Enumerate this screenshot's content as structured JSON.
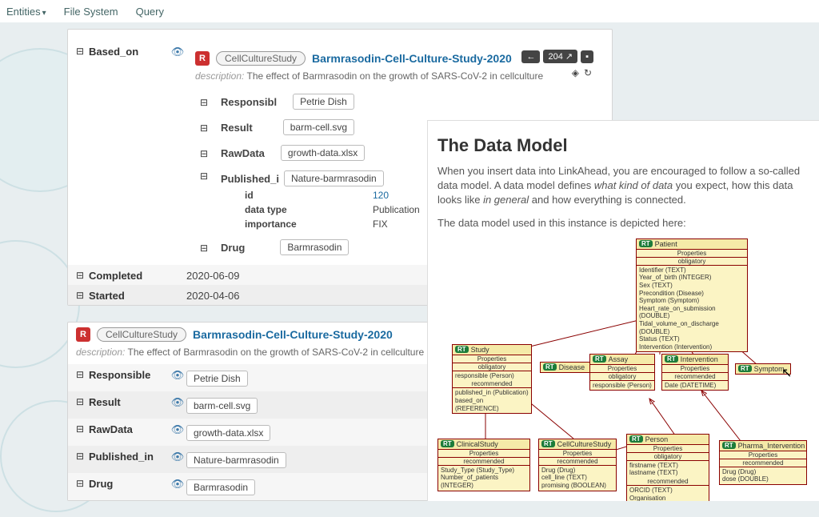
{
  "topbar": {
    "entities": "Entities",
    "fs": "File System",
    "query": "Query"
  },
  "card1": {
    "based_on_label": "Based_on",
    "header": {
      "r": "R",
      "type": "CellCultureStudy",
      "name": "Barmrasodin-Cell-Culture-Study-2020",
      "count": "204"
    },
    "desc_label": "description:",
    "desc": "The effect of Barmrasodin on the growth of SARS-CoV-2 in cellculture",
    "props": {
      "responsible": {
        "label": "Responsibl",
        "value": "Petrie Dish"
      },
      "result": {
        "label": "Result",
        "value": "barm-cell.svg"
      },
      "rawdata": {
        "label": "RawData",
        "value": "growth-data.xlsx"
      },
      "published": {
        "label": "Published_i",
        "value": "Nature-barmrasodin"
      },
      "drug": {
        "label": "Drug",
        "value": "Barmrasodin"
      }
    },
    "pub_details": {
      "id": {
        "k": "id",
        "v": "120"
      },
      "dtype": {
        "k": "data type",
        "v": "Publication"
      },
      "imp": {
        "k": "importance",
        "v": "FIX"
      }
    },
    "completed": {
      "label": "Completed",
      "value": "2020-06-09"
    },
    "started": {
      "label": "Started",
      "value": "2020-04-06"
    }
  },
  "card2": {
    "header": {
      "r": "R",
      "type": "CellCultureStudy",
      "name": "Barmrasodin-Cell-Culture-Study-2020"
    },
    "desc_label": "description:",
    "desc": "The effect of Barmrasodin on the growth of SARS-CoV-2 in cellculture",
    "rows": [
      {
        "label": "Responsible",
        "value": "Petrie Dish"
      },
      {
        "label": "Result",
        "value": "barm-cell.svg"
      },
      {
        "label": "RawData",
        "value": "growth-data.xlsx"
      },
      {
        "label": "Published_in",
        "value": "Nature-barmrasodin"
      },
      {
        "label": "Drug",
        "value": "Barmrasodin"
      }
    ]
  },
  "overlay": {
    "title": "The Data Model",
    "p1a": "When you insert data into LinkAhead, you are encouraged to follow a so-called data model. A data model defines ",
    "p1b": "what kind of data",
    "p1c": " you expect, how this data looks like ",
    "p1d": "in general",
    "p1e": " and how everything is connected.",
    "p2": "The data model used in this instance is depicted here:"
  },
  "diagram": {
    "patient": {
      "name": "Patient",
      "sec1": "Properties",
      "sec2": "obligatory",
      "b1": "Identifier (TEXT)",
      "b2": "Year_of_birth (INTEGER)",
      "b3": "Sex (TEXT)",
      "b4": "Precondition (Disease)",
      "b5": "Symptom (Symptom)",
      "b6": "Heart_rate_on_submission (DOUBLE)",
      "b7": "Tidal_volume_on_discharge (DOUBLE)",
      "b8": "Status (TEXT)",
      "b9": "Intervention (Intervention)"
    },
    "study": {
      "name": "Study",
      "sec1": "Properties",
      "sec2": "obligatory",
      "b1": "responsible (Person)",
      "sec3": "recommended",
      "b2": "published_in (Publication)",
      "b3": "based_on (REFERENCE)"
    },
    "disease": {
      "name": "Disease"
    },
    "assay": {
      "name": "Assay",
      "sec1": "Properties",
      "sec2": "obligatory",
      "b1": "responsible (Person)"
    },
    "intervention": {
      "name": "Intervention",
      "sec1": "Properties",
      "sec2": "recommended",
      "b1": "Date (DATETIME)"
    },
    "symptom": {
      "name": "Symptom"
    },
    "clinical": {
      "name": "ClinicalStudy",
      "sec1": "Properties",
      "sec2": "recommended",
      "b1": "Study_Type (Study_Type)",
      "b2": "Number_of_patients (INTEGER)"
    },
    "cellculture": {
      "name": "CellCultureStudy",
      "sec1": "Properties",
      "sec2": "recommended",
      "b1": "Drug (Drug)",
      "b2": "cell_line (TEXT)",
      "b3": "promising (BOOLEAN)"
    },
    "person": {
      "name": "Person",
      "sec1": "Properties",
      "sec2": "obligatory",
      "b1": "firstname (TEXT)",
      "b2": "lastname (TEXT)",
      "sec3": "recommended",
      "b3": "ORCID (TEXT)",
      "b4": "Organisation (Organisation)"
    },
    "pharma": {
      "name": "Pharma_Intervention",
      "sec1": "Properties",
      "sec2": "recommended",
      "b1": "Drug (Drug)",
      "b2": "dose (DOUBLE)"
    }
  }
}
